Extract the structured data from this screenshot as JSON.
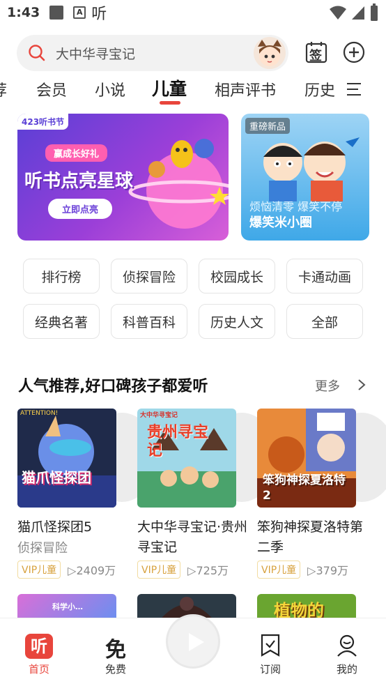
{
  "status": {
    "time": "1:43",
    "app_glyph": "听",
    "a_badge": "A"
  },
  "search": {
    "placeholder": "大中华寻宝记"
  },
  "header": {
    "checkin_label": "签"
  },
  "tabs": [
    "荐",
    "会员",
    "小说",
    "儿童",
    "相声评书",
    "历史"
  ],
  "active_tab": "儿童",
  "banners": [
    {
      "tag": "423听书节",
      "ribbon": "赢成长好礼",
      "headline": "听书点亮星球",
      "button": "立即点亮"
    },
    {
      "tag": "重磅新品",
      "line1": "烦恼清零 爆笑不停",
      "line2": "爆笑米小圈"
    }
  ],
  "categories": [
    "排行榜",
    "侦探冒险",
    "校园成长",
    "卡通动画",
    "经典名著",
    "科普百科",
    "历史人文",
    "全部"
  ],
  "section": {
    "title": "人气推荐,好口碑孩子都爱听",
    "more": "更多",
    "more_icon": "chevron-right-icon"
  },
  "cards": [
    {
      "title": "猫爪怪探团5",
      "subtitle": "侦探冒险",
      "cover_text": "猫爪怪探团",
      "cover_top": "ATTENTION!",
      "badge": "",
      "plays": "",
      "color": "#3a58b8"
    },
    {
      "title": "大中华寻宝记·贵州寻宝记",
      "subtitle": "",
      "cover_text": "贵州寻宝记",
      "cover_top": "大中华寻宝记",
      "badge": "VIP儿童",
      "plays": "▷725万",
      "color": "#4aa36c"
    },
    {
      "title": "笨狗神探夏洛特第二季",
      "subtitle": "",
      "cover_text": "笨狗神探夏洛特2",
      "cover_top": "",
      "badge": "VIP儿童",
      "plays": "▷379万",
      "color": "#c0491e"
    }
  ],
  "card_meta": [
    {
      "badge": "VIP儿童",
      "plays": "▷2409万"
    }
  ],
  "peek_covers": [
    {
      "text": "科学小…",
      "color": "#8c5fd9"
    },
    {
      "text": "",
      "color": "#2c3a45"
    },
    {
      "text": "植物的",
      "color": "#6aa530"
    }
  ],
  "nav": [
    {
      "label": "首页",
      "icon": "home-logo-icon"
    },
    {
      "label": "免费",
      "icon": "free-icon",
      "glyph": "免"
    },
    {
      "label": "",
      "icon": "play-icon"
    },
    {
      "label": "订阅",
      "icon": "subscribe-icon"
    },
    {
      "label": "我的",
      "icon": "profile-icon"
    }
  ],
  "colors": {
    "accent": "#e8453c",
    "vip": "#d7a13d"
  }
}
